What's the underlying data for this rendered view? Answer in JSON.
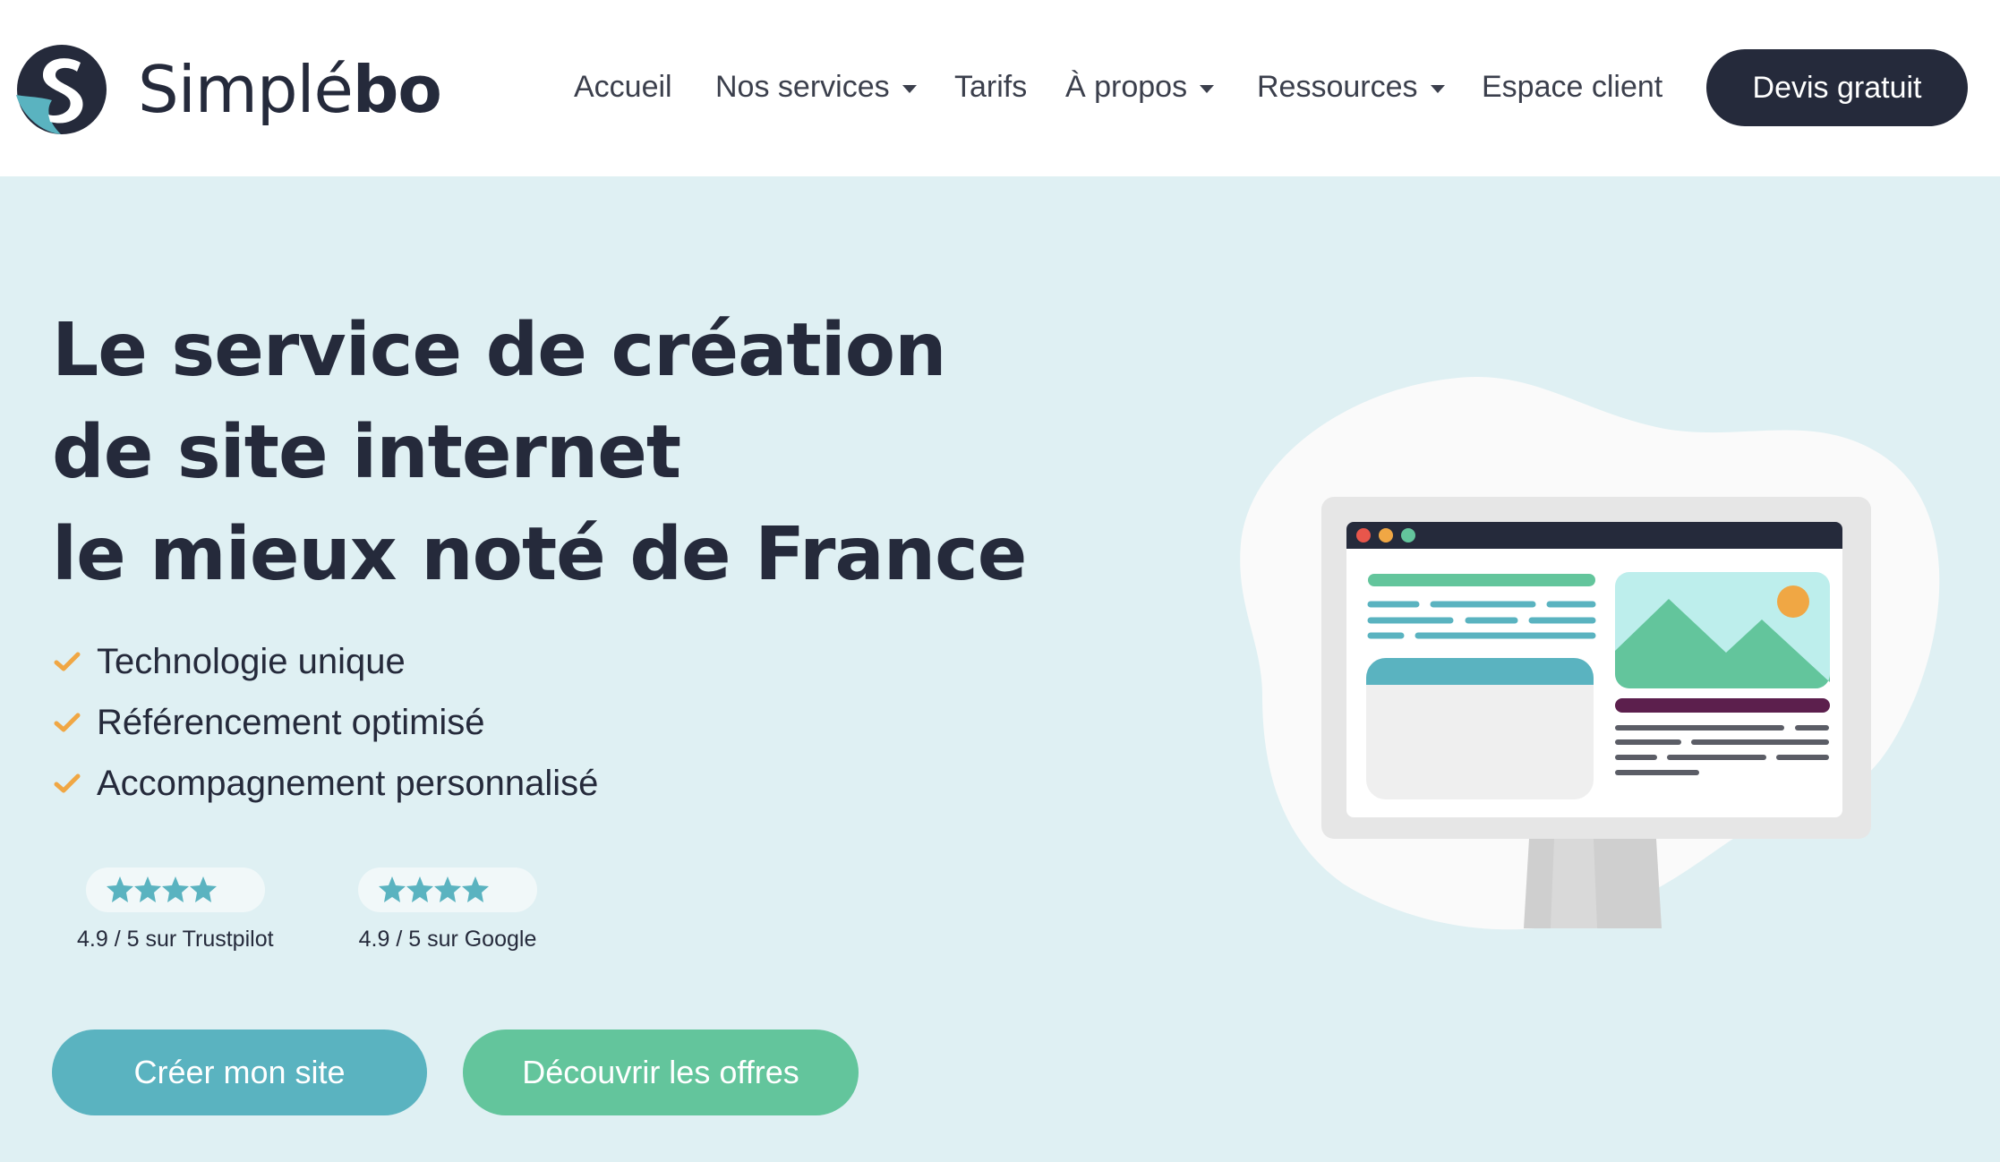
{
  "brand": {
    "name_light": "Simplé",
    "name_bold": "bo",
    "colors": {
      "dark": "#252a3b",
      "teal": "#5ab3c0",
      "green": "#63c59c",
      "hero_bg": "#dff0f3",
      "check": "#f0a744"
    }
  },
  "nav": {
    "items": [
      {
        "label": "Accueil",
        "dropdown": false
      },
      {
        "label": "Nos services",
        "dropdown": true
      },
      {
        "label": "Tarifs",
        "dropdown": false
      },
      {
        "label": "À propos",
        "dropdown": true
      },
      {
        "label": "Ressources",
        "dropdown": true
      },
      {
        "label": "Espace client",
        "dropdown": false
      }
    ],
    "cta": "Devis gratuit"
  },
  "hero": {
    "headline": [
      "Le service de création",
      "de site internet",
      "le mieux noté de France"
    ],
    "features": [
      "Technologie unique",
      "Référencement optimisé",
      "Accompagnement personnalisé"
    ],
    "ratings": [
      {
        "label": "4.9 / 5 sur Trustpilot",
        "score": 4.9,
        "max": 5
      },
      {
        "label": "4.9 / 5 sur Google",
        "score": 4.9,
        "max": 5
      }
    ],
    "buttons": {
      "primary": "Créer mon site",
      "secondary": "Découvrir les offres"
    }
  }
}
